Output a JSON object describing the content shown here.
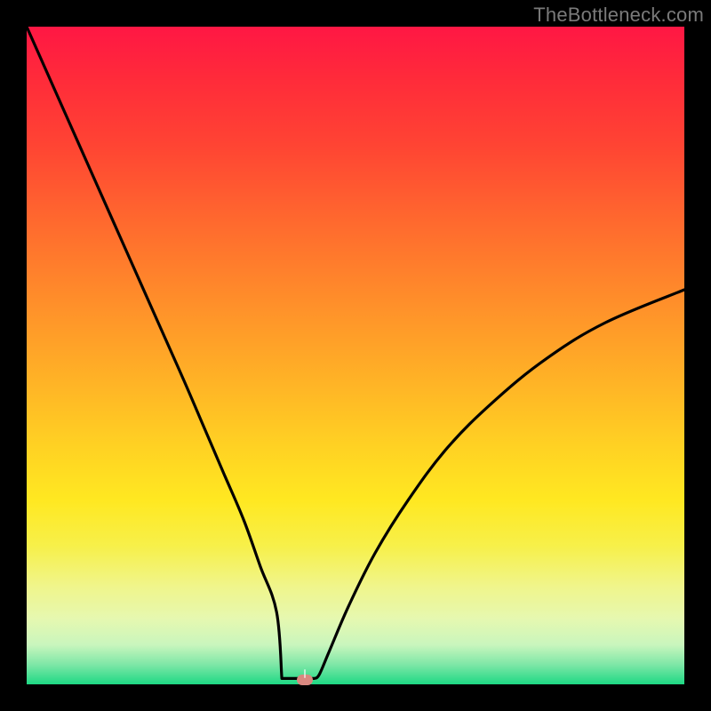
{
  "watermark": "TheBottleneck.com",
  "dot": {
    "x_pct": 42.3,
    "y_pct": 99.3
  },
  "chart_data": {
    "type": "line",
    "title": "",
    "xlabel": "",
    "ylabel": "",
    "xlim": [
      0,
      100
    ],
    "ylim": [
      0,
      100
    ],
    "series": [
      {
        "name": "curve",
        "x": [
          0,
          4,
          8,
          12,
          16,
          20,
          24,
          27,
          30,
          33,
          35.5,
          38,
          40,
          41.5,
          43,
          44.5,
          46,
          49,
          53,
          58,
          64,
          71,
          79,
          88,
          100
        ],
        "y": [
          100,
          91,
          82,
          73,
          64,
          55,
          46,
          39,
          32,
          25,
          18,
          11,
          5,
          1.5,
          0.7,
          1.5,
          5,
          12,
          20,
          28,
          36,
          43,
          49.5,
          55,
          60
        ]
      }
    ],
    "flat_segment": {
      "x_start_pct": 38.8,
      "x_end_pct": 43.8,
      "y_pct": 0.9
    },
    "gradient_stops": [
      {
        "pct": 0,
        "color": "#ff1744"
      },
      {
        "pct": 8,
        "color": "#ff2b3a"
      },
      {
        "pct": 18,
        "color": "#ff4433"
      },
      {
        "pct": 30,
        "color": "#ff6a2e"
      },
      {
        "pct": 42,
        "color": "#ff8f2a"
      },
      {
        "pct": 54,
        "color": "#ffb326"
      },
      {
        "pct": 64,
        "color": "#ffd223"
      },
      {
        "pct": 72,
        "color": "#ffe821"
      },
      {
        "pct": 79,
        "color": "#f7f04a"
      },
      {
        "pct": 85,
        "color": "#f0f58a"
      },
      {
        "pct": 90,
        "color": "#e6f8b0"
      },
      {
        "pct": 94,
        "color": "#c9f6bd"
      },
      {
        "pct": 97,
        "color": "#7ee7a7"
      },
      {
        "pct": 100,
        "color": "#1ed884"
      }
    ]
  }
}
